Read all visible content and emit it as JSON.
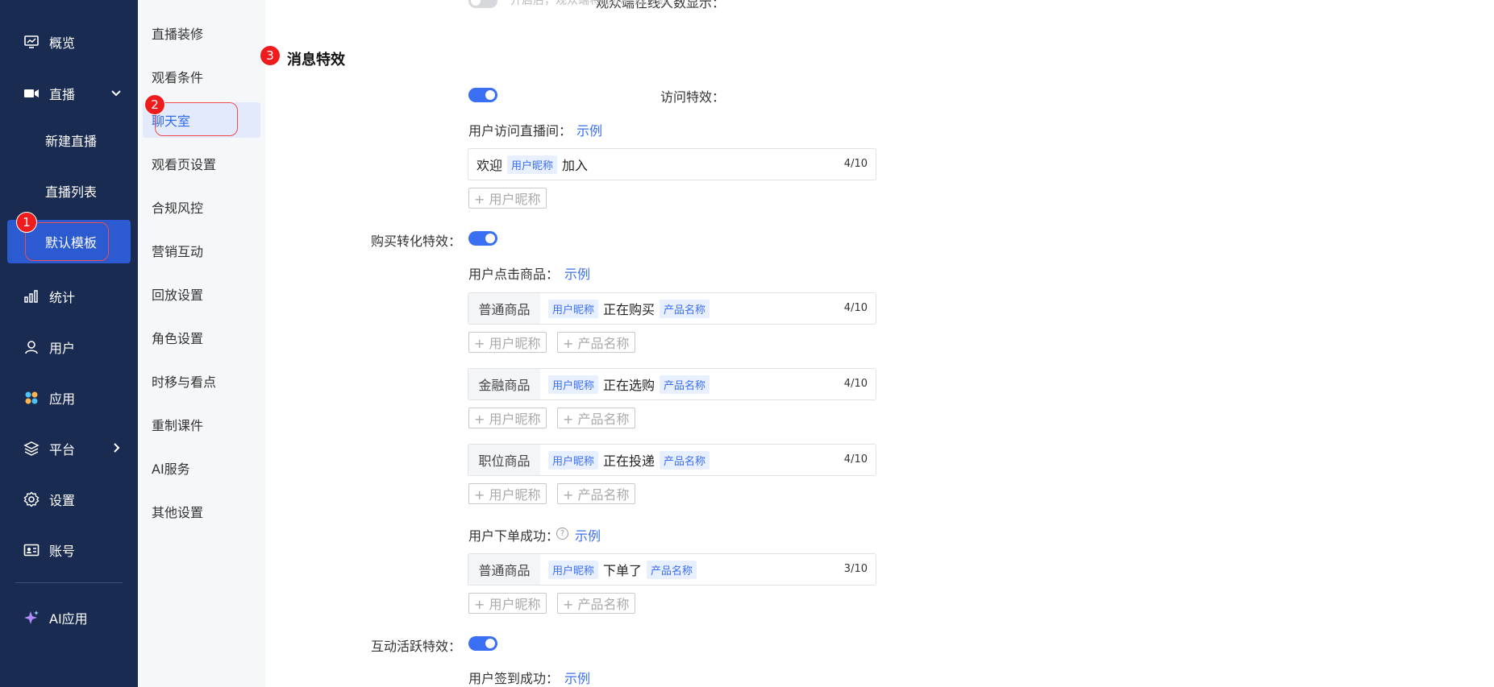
{
  "sidebar": {
    "items": [
      {
        "label": "概览",
        "icon": "monitor-icon"
      },
      {
        "label": "直播",
        "icon": "video-camera-icon"
      },
      {
        "label": "统计",
        "icon": "bar-chart-icon"
      },
      {
        "label": "用户",
        "icon": "user-icon"
      },
      {
        "label": "应用",
        "icon": "apps-icon"
      },
      {
        "label": "平台",
        "icon": "layers-icon"
      },
      {
        "label": "设置",
        "icon": "gear-icon"
      },
      {
        "label": "账号",
        "icon": "id-card-icon"
      },
      {
        "label": "AI应用",
        "icon": "sparkle-icon"
      }
    ],
    "live_sub": [
      {
        "label": "新建直播"
      },
      {
        "label": "直播列表"
      },
      {
        "label": "默认模板"
      }
    ]
  },
  "sub_sidebar": {
    "items": [
      {
        "label": "直播装修"
      },
      {
        "label": "观看条件"
      },
      {
        "label": "聊天室"
      },
      {
        "label": "观看页设置"
      },
      {
        "label": "合规风控"
      },
      {
        "label": "营销互动"
      },
      {
        "label": "回放设置"
      },
      {
        "label": "角色设置"
      },
      {
        "label": "时移与看点"
      },
      {
        "label": "重制课件"
      },
      {
        "label": "AI服务"
      },
      {
        "label": "其他设置"
      }
    ]
  },
  "badges": [
    "1",
    "2",
    "3"
  ],
  "top_row": {
    "label": "观众端在线人数显示：",
    "hint": "开启后，观众端将显示在线人数"
  },
  "section": {
    "title": "消息特效"
  },
  "visit": {
    "label": "访问特效：",
    "sub_label": "用户访问直播间：",
    "example": "示例",
    "before": "欢迎",
    "tag": "用户昵称",
    "after": "加入",
    "count": "4/10",
    "insert_nick": "+ 用户昵称"
  },
  "purchase": {
    "label": "购买转化特效：",
    "click_label": "用户点击商品：",
    "example": "示例",
    "rows": [
      {
        "prefix": "普通商品",
        "tag_user": "用户昵称",
        "verb": "正在购买",
        "tag_product": "产品名称",
        "count": "4/10",
        "ins_user": "+ 用户昵称",
        "ins_product": "+ 产品名称"
      },
      {
        "prefix": "金融商品",
        "tag_user": "用户昵称",
        "verb": "正在选购",
        "tag_product": "产品名称",
        "count": "4/10",
        "ins_user": "+ 用户昵称",
        "ins_product": "+ 产品名称"
      },
      {
        "prefix": "职位商品",
        "tag_user": "用户昵称",
        "verb": "正在投递",
        "tag_product": "产品名称",
        "count": "4/10",
        "ins_user": "+ 用户昵称",
        "ins_product": "+ 产品名称"
      }
    ],
    "order_label": "用户下单成功：",
    "order_help": "?",
    "order_example": "示例",
    "order_row": {
      "prefix": "普通商品",
      "tag_user": "用户昵称",
      "verb": "下单了",
      "tag_product": "产品名称",
      "count": "3/10",
      "ins_user": "+ 用户昵称",
      "ins_product": "+ 产品名称"
    }
  },
  "interaction": {
    "label": "互动活跃特效：",
    "sub_label": "用户签到成功：",
    "example": "示例"
  },
  "colors": {
    "sidebar_bg": "#1a2b52",
    "active_blue": "#2b5ad1",
    "accent": "#3a6ff3",
    "badge_red": "#ee1c1c"
  }
}
